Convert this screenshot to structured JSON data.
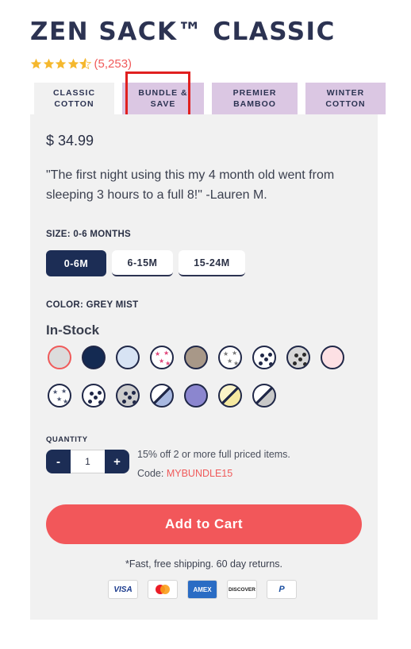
{
  "product": {
    "title": "ZEN SACK™ CLASSIC",
    "rating": {
      "stars": 4.6,
      "count": "(5,253)"
    }
  },
  "tabs": [
    {
      "label": "CLASSIC COTTON",
      "active": true
    },
    {
      "label": "BUNDLE & SAVE",
      "active": false
    },
    {
      "label": "PREMIER BAMBOO",
      "active": false
    },
    {
      "label": "WINTER COTTON",
      "active": false
    }
  ],
  "price": "$ 34.99",
  "quote": "\"The first night using this my 4 month old went from sleeping 3 hours to a full 8!\" -Lauren M.",
  "size": {
    "label": "SIZE: 0-6 MONTHS",
    "options": [
      "0-6M",
      "6-15M",
      "15-24M"
    ],
    "selected": "0-6M"
  },
  "color": {
    "label": "COLOR: GREY MIST",
    "stock": "In-Stock",
    "swatches": [
      {
        "name": "grey-mist",
        "fill": "#dcdcdc",
        "selected": true
      },
      {
        "name": "navy",
        "fill": "#142a52"
      },
      {
        "name": "light-blue",
        "fill": "#d7e3f4"
      },
      {
        "name": "pink-stars",
        "fill": "#ffffff",
        "pattern": "stars",
        "dot": "#e0457a"
      },
      {
        "name": "taupe",
        "fill": "#a89888"
      },
      {
        "name": "grey-stars",
        "fill": "#ffffff",
        "pattern": "stars",
        "dot": "#777777"
      },
      {
        "name": "navy-dots",
        "fill": "#ffffff",
        "pattern": "dots",
        "dot": "#1f2747"
      },
      {
        "name": "grey-dots",
        "fill": "#d6d6d6",
        "pattern": "dots",
        "dot": "#2a2a2a"
      },
      {
        "name": "blush",
        "fill": "#fde0e4"
      },
      {
        "name": "blue-stars",
        "fill": "#ffffff",
        "pattern": "stars",
        "dot": "#4a5470"
      },
      {
        "name": "white-dots",
        "fill": "#ffffff",
        "pattern": "dots",
        "dot": "#1f2747"
      },
      {
        "name": "grey-triangles",
        "fill": "#cccccc",
        "pattern": "dots",
        "dot": "#1f2747"
      },
      {
        "name": "blue-white",
        "fill": "#ffffff",
        "pattern": "split",
        "dot": "#a8b8e0"
      },
      {
        "name": "lavender",
        "fill": "#8b86cf"
      },
      {
        "name": "yellow-white",
        "fill": "#fbf4c8",
        "pattern": "split",
        "dot": "#f6e9a0"
      },
      {
        "name": "grey-pattern",
        "fill": "#ffffff",
        "pattern": "split",
        "dot": "#c8c8c8"
      }
    ]
  },
  "quantity": {
    "label": "QUANTITY",
    "minus": "-",
    "plus": "+",
    "value": "1"
  },
  "promo": {
    "text": "15% off 2 or more full priced items. Code: ",
    "code": "MYBUNDLE15"
  },
  "cta": {
    "add_to_cart": "Add to Cart"
  },
  "shipping_note": "*Fast, free shipping. 60 day returns.",
  "payments": [
    "VISA",
    "mastercard",
    "AMEX",
    "DISCOVER",
    "PayPal"
  ],
  "colors": {
    "accent": "#f2575a",
    "navy": "#1c2d55",
    "tab_purple": "#dbc7e3",
    "panel": "#f1f1f1",
    "highlight": "#e02020"
  }
}
